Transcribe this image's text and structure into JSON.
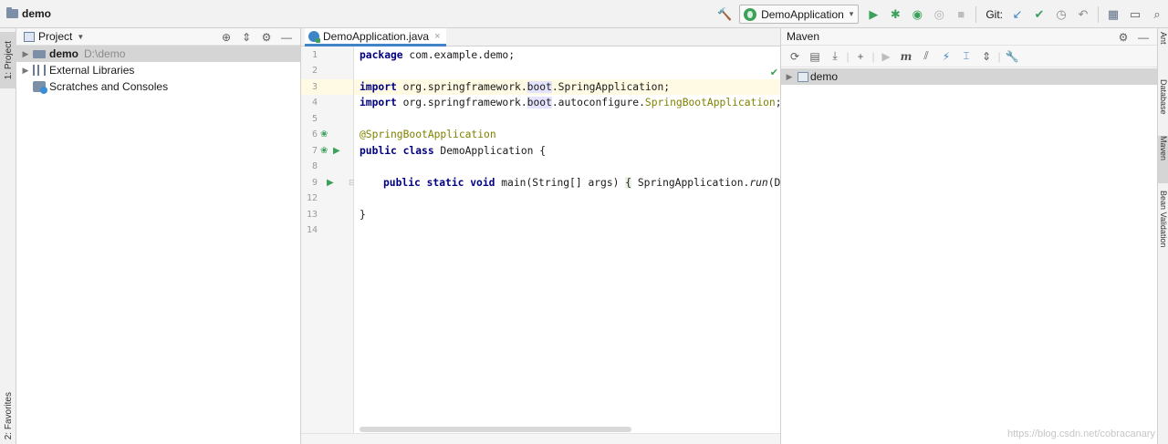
{
  "navbar": {
    "breadcrumb": "demo",
    "run_config": "DemoApplication",
    "git_label": "Git:",
    "icons": [
      "build-hammer-icon",
      "run-icon",
      "debug-icon",
      "coverage-icon",
      "profile-icon",
      "stop-icon",
      "git-update-icon",
      "git-commit-icon",
      "history-icon",
      "rollback-icon",
      "project-structure-icon",
      "terminal-icon"
    ]
  },
  "left_strip": {
    "project_tab": "1: Project",
    "favorites_tab": "2: Favorites"
  },
  "project_panel": {
    "title": "Project",
    "tree": [
      {
        "label": "demo",
        "path": "D:\\demo",
        "bold": true,
        "selected": true
      },
      {
        "label": "External Libraries",
        "path": "",
        "bold": false,
        "selected": false
      },
      {
        "label": "Scratches and Consoles",
        "path": "",
        "bold": false,
        "selected": false
      }
    ]
  },
  "editor": {
    "tab_label": "DemoApplication.java",
    "tab_close": "×",
    "line_numbers": [
      "1",
      "2",
      "3",
      "4",
      "5",
      "6",
      "7",
      "8",
      "9",
      "12",
      "13",
      "14"
    ],
    "code": {
      "l1_kw": "package",
      "l1_rest": " com.example.demo;",
      "l3_kw": "import",
      "l3_a": " org.springframework.",
      "l3_boot": "boot",
      "l3_b": ".SpringApplication;",
      "l4_kw": "import",
      "l4_a": " org.springframework.",
      "l4_boot": "boot",
      "l4_b": ".autoconfigure.",
      "l4_cls": "SpringBootApplication",
      "l4_end": ";",
      "l6_ann": "@SpringBootApplication",
      "l7_kw": "public class",
      "l7_rest": " DemoApplication {",
      "l9_kw": "public static void",
      "l9_a": " main(String[] args) ",
      "l9_brace": "{",
      "l9_b": " SpringApplication.",
      "l9_run": "run",
      "l9_c": "(De",
      "l13": "}"
    }
  },
  "maven_panel": {
    "title": "Maven",
    "root_label": "demo"
  },
  "right_strip": {
    "tabs": [
      "Ant",
      "Database",
      "Maven",
      "Bean Validation"
    ]
  },
  "watermark": "https://blog.csdn.net/cobracanary"
}
